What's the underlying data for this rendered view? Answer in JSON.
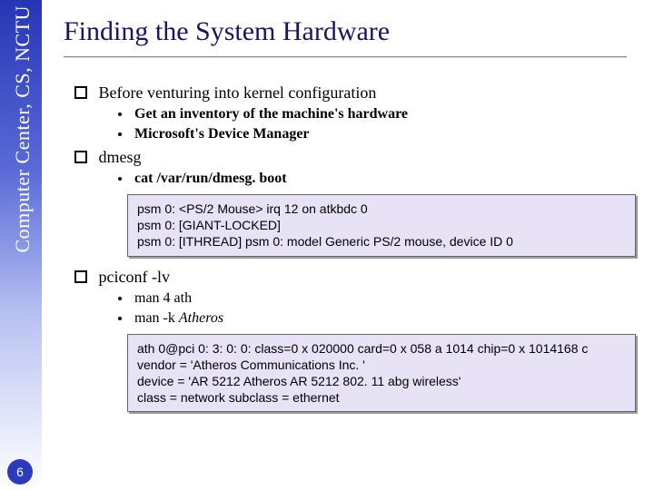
{
  "sidebar_text": "Computer Center, CS, NCTU",
  "page_number": "6",
  "title": "Finding the System Hardware",
  "b1": {
    "text": "Before venturing into kernel configuration",
    "sub1a": "Get an inventory of the machine's hardware",
    "sub1b_prefix": "Microsoft's ",
    "sub1b_bold": "Device Manager"
  },
  "b2": {
    "text": "dmesg",
    "sub2a_prefix": "cat ",
    "sub2a_bold": "/var/run/dmesg. boot",
    "output": "psm 0: <PS/2 Mouse> irq 12 on atkbdc 0\npsm 0: [GIANT-LOCKED]\npsm 0: [ITHREAD] psm 0: model Generic PS/2 mouse, device ID 0"
  },
  "b3": {
    "text": "pciconf -lv",
    "sub3a": "man 4 ath",
    "sub3b_prefix": "man -k ",
    "sub3b_italic": "Atheros",
    "output": "ath 0@pci 0: 3: 0: 0: class=0 x 020000 card=0 x 058 a 1014 chip=0 x 1014168 c\nvendor = 'Atheros Communications Inc. '\ndevice = 'AR 5212 Atheros AR 5212 802. 11 abg wireless'\nclass = network subclass = ethernet"
  }
}
